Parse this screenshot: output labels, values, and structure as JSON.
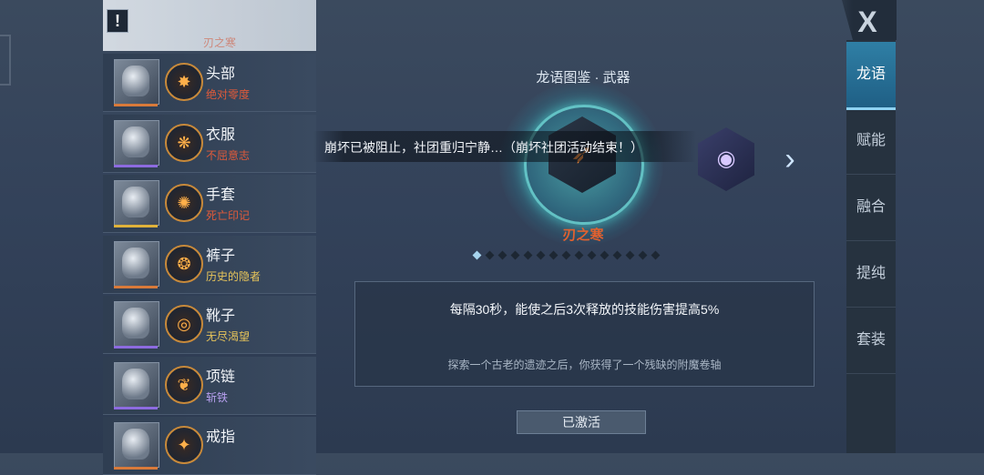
{
  "alert_icon_text": "!",
  "top_partial_item": {
    "sub": "刃之寒"
  },
  "equipment": [
    {
      "name": "头部",
      "enchant": "绝对零度",
      "enchant_color": "#e05a3a",
      "icon": "helmet-icon",
      "bar_color": "#d97a3a",
      "glyph": "✸"
    },
    {
      "name": "衣服",
      "enchant": "不屈意志",
      "enchant_color": "#e05a3a",
      "icon": "armor-icon",
      "bar_color": "#8d6be0",
      "glyph": "❋"
    },
    {
      "name": "手套",
      "enchant": "死亡印记",
      "enchant_color": "#e05a3a",
      "icon": "gloves-icon",
      "bar_color": "#e0b23a",
      "glyph": "✺"
    },
    {
      "name": "裤子",
      "enchant": "历史的隐者",
      "enchant_color": "#e8c55a",
      "icon": "pants-icon",
      "bar_color": "#d97a3a",
      "glyph": "❂"
    },
    {
      "name": "靴子",
      "enchant": "无尽渴望",
      "enchant_color": "#e8c55a",
      "icon": "boots-icon",
      "bar_color": "#8d6be0",
      "glyph": "◎"
    },
    {
      "name": "项链",
      "enchant": "斩铁",
      "enchant_color": "#b8a0f0",
      "icon": "necklace-icon",
      "bar_color": "#8d6be0",
      "glyph": "❦"
    },
    {
      "name": "戒指",
      "enchant": "",
      "enchant_color": "#e05a3a",
      "icon": "ring-icon",
      "bar_color": "#d97a3a",
      "glyph": "✦"
    }
  ],
  "center": {
    "title": "龙语图鉴 · 武器",
    "banner": "崩坏已被阻止，社团重归宁静…（崩坏社团活动结束！）",
    "emblem_name": "刃之寒",
    "dots_total": 15,
    "dots_active": 0,
    "description": "每隔30秒，能使之后3次释放的技能伤害提高5%",
    "flavor": "探索一个古老的遗迹之后，你获得了一个残缺的附魔卷轴",
    "status_button": "已激活"
  },
  "nav": {
    "close_label": "X",
    "items": [
      "龙语",
      "赋能",
      "融合",
      "提纯",
      "套装"
    ],
    "active_index": 0
  }
}
